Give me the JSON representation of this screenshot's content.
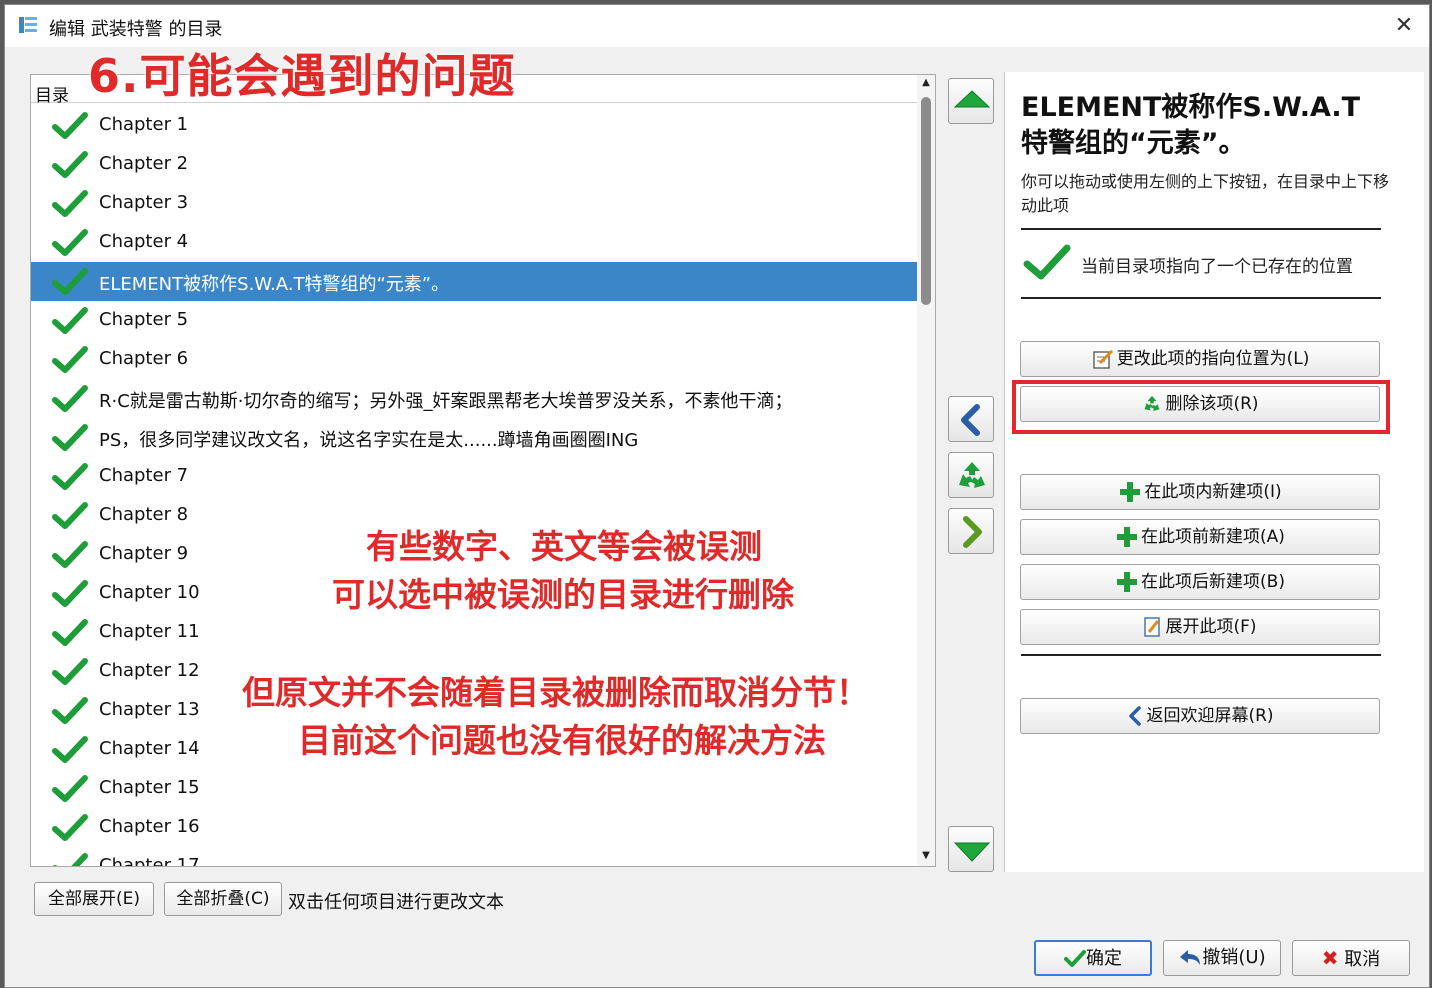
{
  "window": {
    "title": "编辑 武装特警 的目录"
  },
  "annotation": {
    "heading": "6.可能会遇到的问题",
    "line1": "有些数字、英文等会被误测",
    "line2": "可以选中被误测的目录进行删除",
    "line3": "但原文并不会随着目录被删除而取消分节！",
    "line4": "目前这个问题也没有很好的解决方法"
  },
  "toc": {
    "header": "目录",
    "items": [
      {
        "label": "Chapter 1",
        "selected": false
      },
      {
        "label": "Chapter 2",
        "selected": false
      },
      {
        "label": "Chapter 3",
        "selected": false
      },
      {
        "label": "Chapter 4",
        "selected": false
      },
      {
        "label": "ELEMENT被称作S.W.A.T特警组的“元素”。",
        "selected": true
      },
      {
        "label": "Chapter 5",
        "selected": false
      },
      {
        "label": "Chapter 6",
        "selected": false
      },
      {
        "label": "R·C就是雷古勒斯·切尔奇的缩写；另外强_奸案跟黑帮老大埃普罗没关系，不素他干滴；",
        "selected": false
      },
      {
        "label": "PS，很多同学建议改文名，说这名字实在是太......蹲墙角画圈圈ING",
        "selected": false
      },
      {
        "label": "Chapter 7",
        "selected": false
      },
      {
        "label": "Chapter 8",
        "selected": false
      },
      {
        "label": "Chapter 9",
        "selected": false
      },
      {
        "label": "Chapter 10",
        "selected": false
      },
      {
        "label": "Chapter 11",
        "selected": false
      },
      {
        "label": "Chapter 12",
        "selected": false
      },
      {
        "label": "Chapter 13",
        "selected": false
      },
      {
        "label": "Chapter 14",
        "selected": false
      },
      {
        "label": "Chapter 15",
        "selected": false
      },
      {
        "label": "Chapter 16",
        "selected": false
      },
      {
        "label": "Chapter 17",
        "selected": false
      }
    ]
  },
  "details": {
    "title": "ELEMENT被称作S.W.A.T特警组的“元素”。",
    "description": "你可以拖动或使用左侧的上下按钮，在目录中上下移动此项",
    "status": "当前目录项指向了一个已存在的位置"
  },
  "actions": {
    "change_location": "更改此项的指向位置为(L)",
    "delete": "删除该项(R)",
    "new_child": "在此项内新建项(I)",
    "new_before": "在此项前新建项(A)",
    "new_after": "在此项后新建项(B)",
    "expand": "展开此项(F)",
    "back": "返回欢迎屏幕(R)"
  },
  "bottom": {
    "expand_all": "全部展开(E)",
    "collapse_all": "全部折叠(C)",
    "hint": "双击任何项目进行更改文本"
  },
  "footer": {
    "ok": "确定",
    "undo": "撤销(U)",
    "cancel": "取消"
  },
  "colors": {
    "selection": "#3a86c8",
    "check_green": "#1e9e3a",
    "annotation_red": "#e02a2a",
    "highlight_red": "#e0282d"
  }
}
